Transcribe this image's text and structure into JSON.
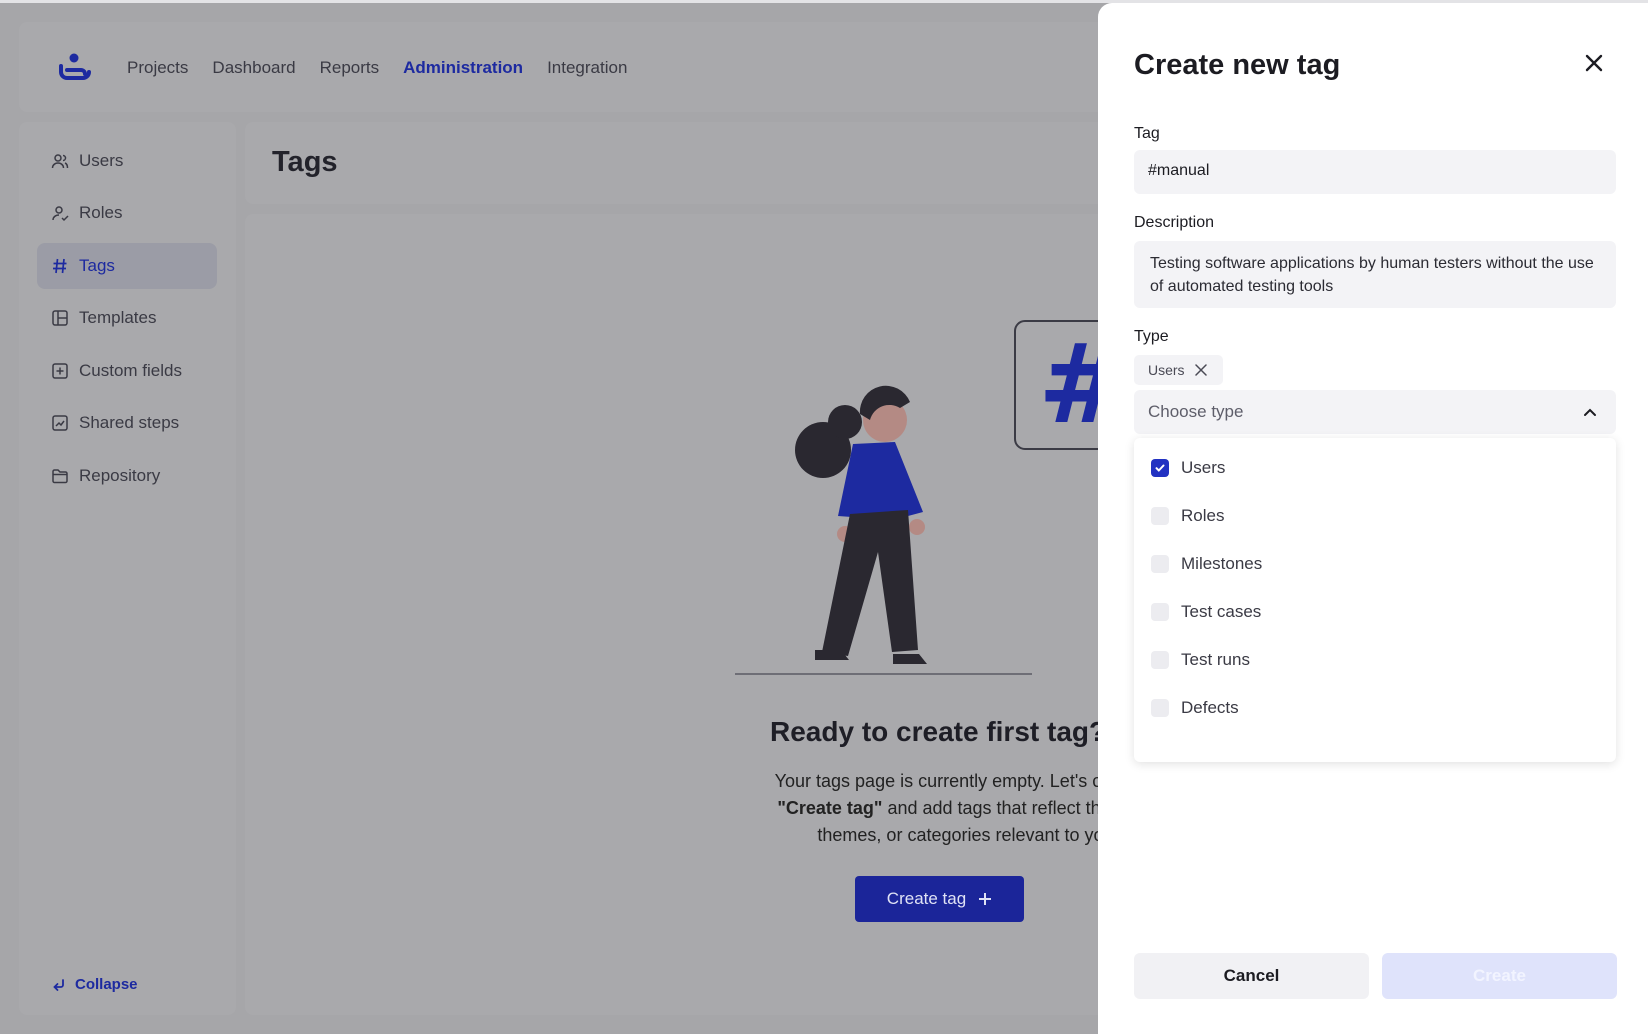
{
  "nav": {
    "items": [
      "Projects",
      "Dashboard",
      "Reports",
      "Administration",
      "Integration"
    ],
    "active": "Administration"
  },
  "sidebar": {
    "items": [
      {
        "label": "Users",
        "icon": "users-icon"
      },
      {
        "label": "Roles",
        "icon": "roles-icon"
      },
      {
        "label": "Tags",
        "icon": "hash-icon"
      },
      {
        "label": "Templates",
        "icon": "templates-icon"
      },
      {
        "label": "Custom fields",
        "icon": "custom-fields-icon"
      },
      {
        "label": "Shared steps",
        "icon": "shared-steps-icon"
      },
      {
        "label": "Repository",
        "icon": "folder-icon"
      }
    ],
    "active": "Tags",
    "collapse_label": "Collapse"
  },
  "page": {
    "title": "Tags",
    "empty_title": "Ready to create first tag?",
    "empty_text_1": "Your tags page is currently empty. Let's change that! Click",
    "empty_text_bold": "\"Create tag\"",
    "empty_text_2": "and add tags that reflect the specific topics,",
    "empty_text_3": "themes, or categories relevant to your projects.",
    "create_button": "Create tag"
  },
  "panel": {
    "title": "Create new tag",
    "tag_label": "Tag",
    "tag_value": "#manual",
    "description_label": "Description",
    "description_value": "Testing software applications by human testers without the use of automated testing tools",
    "type_label": "Type",
    "selected_chip": "Users",
    "select_placeholder": "Choose type",
    "options": [
      {
        "label": "Users",
        "checked": true
      },
      {
        "label": "Roles",
        "checked": false
      },
      {
        "label": "Milestones",
        "checked": false
      },
      {
        "label": "Test cases",
        "checked": false
      },
      {
        "label": "Test runs",
        "checked": false
      },
      {
        "label": "Defects",
        "checked": false
      }
    ],
    "cancel_label": "Cancel",
    "create_label": "Create"
  },
  "colors": {
    "accent": "#1d2aa0",
    "checkbox_checked": "#2232c2",
    "create_disabled": "#dfe3fb"
  }
}
